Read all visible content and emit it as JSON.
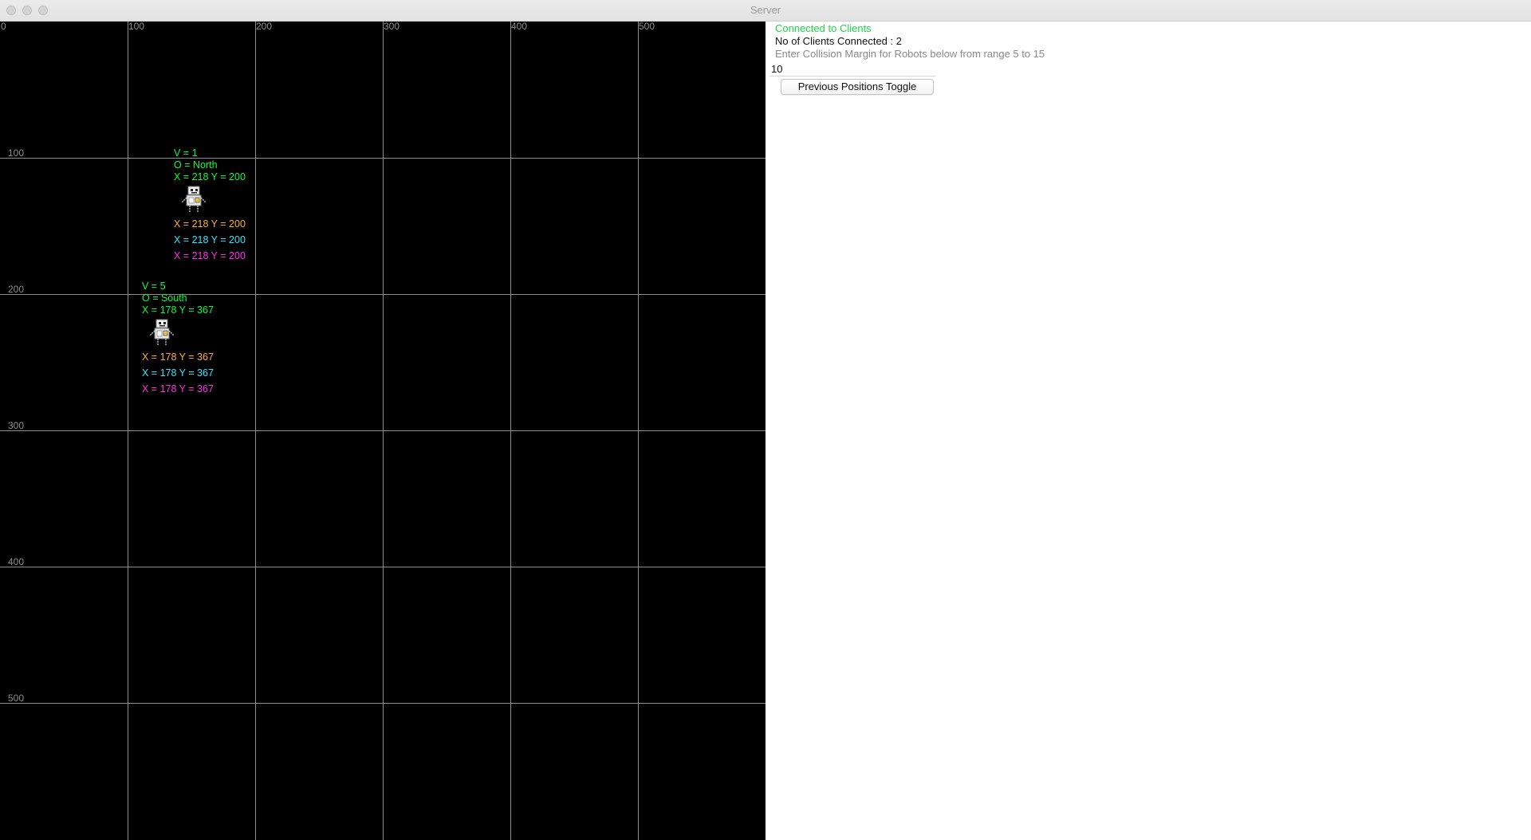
{
  "window": {
    "title": "Server"
  },
  "grid": {
    "x_labels": [
      "0",
      "100",
      "200",
      "300",
      "400",
      "500"
    ],
    "y_labels": [
      "100",
      "200",
      "300",
      "400",
      "500"
    ]
  },
  "robots": [
    {
      "velocity": "V = 1",
      "orientation": "O = North",
      "position": "X = 218 Y = 200",
      "previous_positions": [
        "X = 218 Y = 200",
        "X = 218 Y = 200",
        "X = 218 Y = 200"
      ],
      "icon": "robot-icon"
    },
    {
      "velocity": "V = 5",
      "orientation": "O = South",
      "position": "X = 178 Y = 367",
      "previous_positions": [
        "X = 178 Y = 367",
        "X = 178 Y = 367",
        "X = 178 Y = 367"
      ],
      "icon": "robot-icon"
    }
  ],
  "panel": {
    "status": "Connected to Clients",
    "clients_connected": "No of Clients Connected : 2",
    "margin_prompt": "Enter Collision Margin for Robots below from range 5 to 15",
    "margin_value": "10",
    "toggle_label": "Previous Positions Toggle"
  },
  "colors": {
    "canvas_background": "#000000",
    "grid_line": "#8c8c8c",
    "current_info": "#00ff44",
    "previous_1": "#ffb030",
    "previous_2": "#2ee8ff",
    "previous_3": "#ff2ee8",
    "status_connected": "#19d84a"
  }
}
